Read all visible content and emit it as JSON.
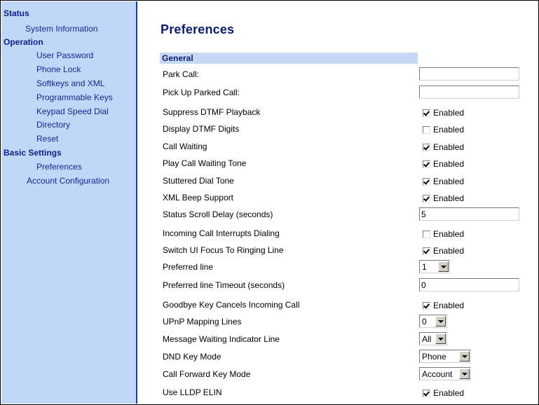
{
  "sidebar": {
    "sections": [
      {
        "title": "Status",
        "items": [
          "System Information"
        ]
      },
      {
        "title": "Operation",
        "items": [
          "User Password",
          "Phone Lock",
          "Softkeys and XML",
          "Programmable Keys",
          "Keypad Speed Dial",
          "Directory",
          "Reset"
        ]
      },
      {
        "title": "Basic Settings",
        "items": [
          "Preferences",
          "Account Configuration"
        ]
      }
    ]
  },
  "main": {
    "title": "Preferences",
    "section": "General",
    "enabled_label": "Enabled",
    "rows": [
      {
        "label": "Park Call:",
        "control": "text",
        "value": ""
      },
      {
        "label": "Pick Up Parked Call:",
        "control": "text",
        "value": ""
      },
      {
        "label": "Suppress DTMF Playback",
        "control": "checkbox",
        "checked": true
      },
      {
        "label": "Display DTMF Digits",
        "control": "checkbox",
        "checked": false
      },
      {
        "label": "Call Waiting",
        "control": "checkbox",
        "checked": true
      },
      {
        "label": "Play Call Waiting Tone",
        "control": "checkbox",
        "checked": true
      },
      {
        "label": "Stuttered Dial Tone",
        "control": "checkbox",
        "checked": true
      },
      {
        "label": "XML Beep Support",
        "control": "checkbox",
        "checked": true
      },
      {
        "label": "Status Scroll Delay (seconds)",
        "control": "text",
        "value": "5"
      },
      {
        "label": "Incoming Call Interrupts Dialing",
        "control": "checkbox",
        "checked": false
      },
      {
        "label": "Switch UI Focus To Ringing Line",
        "control": "checkbox",
        "checked": true
      },
      {
        "label": "Preferred line",
        "control": "select",
        "value": "1"
      },
      {
        "label": "Preferred line Timeout (seconds)",
        "control": "text",
        "value": "0"
      },
      {
        "label": "Goodbye Key Cancels Incoming Call",
        "control": "checkbox",
        "checked": true
      },
      {
        "label": "UPnP Mapping Lines",
        "control": "select",
        "value": "0"
      },
      {
        "label": "Message Waiting Indicator Line",
        "control": "select",
        "value": "All"
      },
      {
        "label": "DND Key Mode",
        "control": "select",
        "value": "Phone"
      },
      {
        "label": "Call Forward Key Mode",
        "control": "select",
        "value": "Account"
      },
      {
        "label": "Use LLDP ELIN",
        "control": "checkbox",
        "checked": true
      }
    ]
  }
}
